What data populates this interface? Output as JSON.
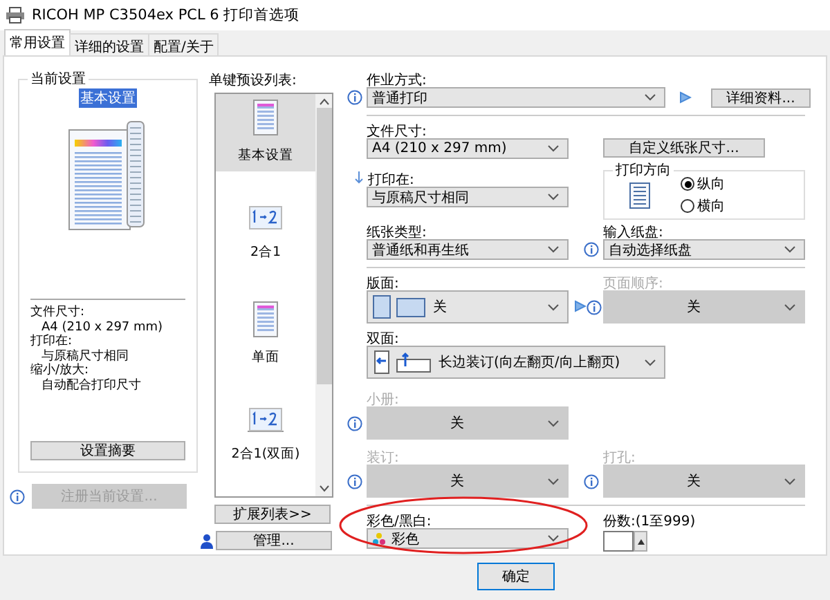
{
  "window": {
    "title": "RICOH MP C3504ex PCL 6 打印首选项"
  },
  "tabs": [
    {
      "label": "常用设置",
      "selected": true
    },
    {
      "label": "详细的设置",
      "selected": false
    },
    {
      "label": "配置/关于",
      "selected": false
    }
  ],
  "current_settings": {
    "title": "当前设置",
    "preset": "基本设置",
    "summary": [
      {
        "label": "文件尺寸:",
        "value": "A4 (210 x 297 mm)"
      },
      {
        "label": "打印在:",
        "value": "与原稿尺寸相同"
      },
      {
        "label": "缩小/放大:",
        "value": "自动配合打印尺寸"
      }
    ],
    "summary_button": "设置摘要",
    "register_button": {
      "label": "注册当前设置...",
      "disabled": true
    }
  },
  "presets": {
    "title": "单键预设列表:",
    "expand_button": "扩展列表>>",
    "manage_button": "管理...",
    "items": [
      {
        "label": "基本设置",
        "kind": "document",
        "selected": true
      },
      {
        "label": "2合1",
        "kind": "two-in-one",
        "selected": false
      },
      {
        "label": "单面",
        "kind": "document",
        "selected": false
      },
      {
        "label": "2合1(双面)",
        "kind": "two-in-one-duplex",
        "selected": false
      }
    ]
  },
  "job_type": {
    "label": "作业方式:",
    "value": "普通打印",
    "details_button": "详细资料..."
  },
  "paper_size": {
    "label": "文件尺寸:",
    "value": "A4 (210 x 297 mm)"
  },
  "custom_size_button": "自定义纸张尺寸...",
  "print_on": {
    "label": "打印在:",
    "value": "与原稿尺寸相同"
  },
  "orientation": {
    "title": "打印方向",
    "options": [
      {
        "label": "纵向",
        "selected": true
      },
      {
        "label": "横向",
        "selected": false
      }
    ]
  },
  "paper_type": {
    "label": "纸张类型:",
    "value": "普通纸和再生纸"
  },
  "input_tray": {
    "label": "输入纸盘:",
    "value": "自动选择纸盘"
  },
  "layout": {
    "label": "版面:",
    "value": "关",
    "disabled": false
  },
  "page_order": {
    "label": "页面顺序:",
    "value": "关",
    "disabled": true
  },
  "duplex": {
    "label": "双面:",
    "value": "长边装订(向左翻页/向上翻页)",
    "disabled": false
  },
  "booklet": {
    "label": "小册:",
    "value": "关",
    "disabled": true
  },
  "staple": {
    "label": "装订:",
    "value": "关",
    "disabled": true
  },
  "punch": {
    "label": "打孔:",
    "value": "关",
    "disabled": true
  },
  "color_mode": {
    "label": "彩色/黑白:",
    "value": "彩色",
    "disabled": false
  },
  "copies": {
    "label": "份数:(1至999)"
  },
  "ok_button": "确定"
}
